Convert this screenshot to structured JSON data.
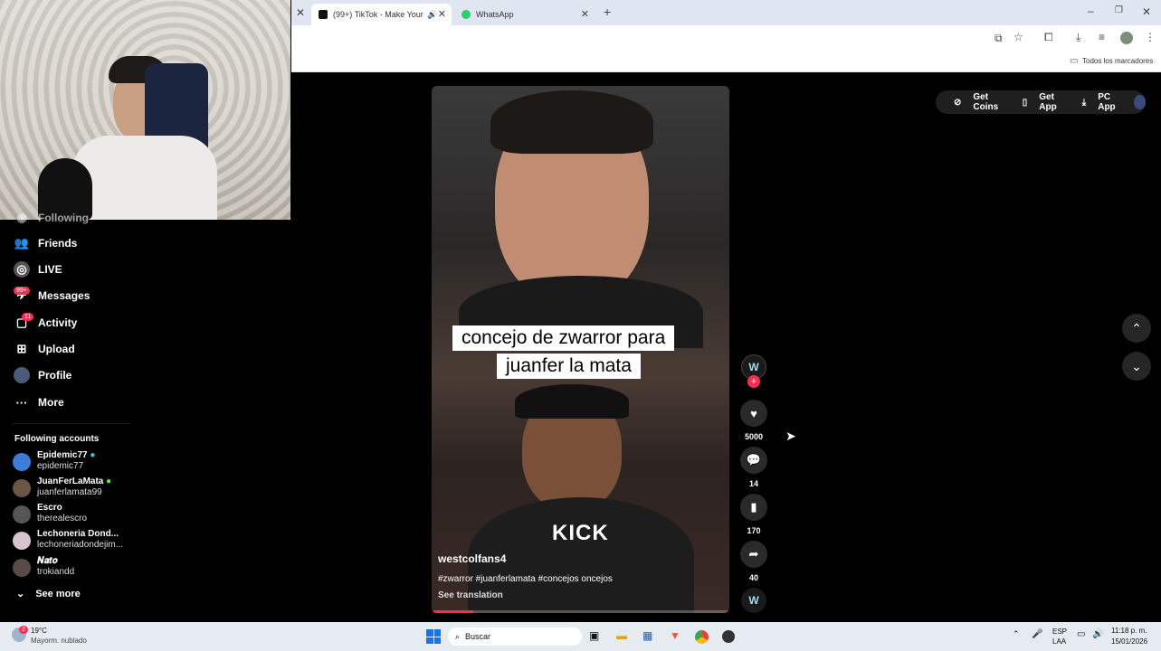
{
  "browser": {
    "tabs": [
      {
        "title": "(99+) TikTok - Make Your D..."
      },
      {
        "title": "WhatsApp"
      }
    ],
    "bookmarks_label": "Todos los marcadores"
  },
  "top_actions": {
    "get_coins": "Get Coins",
    "get_app": "Get App",
    "pc_app": "PC App"
  },
  "sidebar": {
    "partial_item": "Following",
    "items": [
      {
        "label": "Friends",
        "icon": "friends-icon"
      },
      {
        "label": "LIVE",
        "icon": "live-icon"
      },
      {
        "label": "Messages",
        "icon": "messages-icon",
        "badge": "99+"
      },
      {
        "label": "Activity",
        "icon": "activity-icon",
        "badge": "11"
      },
      {
        "label": "Upload",
        "icon": "upload-icon"
      },
      {
        "label": "Profile",
        "icon": "profile-icon"
      },
      {
        "label": "More",
        "icon": "more-icon"
      }
    ],
    "following_title": "Following accounts",
    "accounts": [
      {
        "name": "Epidemic77",
        "user": "epidemic77"
      },
      {
        "name": "JuanFerLaMata",
        "user": "juanferlamata99"
      },
      {
        "name": "Escro",
        "user": "therealescro"
      },
      {
        "name": "Lechoneria Dond...",
        "user": "lechoneriadondejim..."
      },
      {
        "name": "𝑵𝒂𝒕𝒐",
        "user": "trokiandd"
      }
    ],
    "see_more": "See more"
  },
  "video": {
    "caption_line1": "concejo de zwarror para",
    "caption_line2": "juanfer la mata",
    "watermark": "KICK",
    "author": "westcolfans4",
    "hashtags": "#zwarror #juanferlamata #concejos oncejos",
    "see_translation": "See translation",
    "progress": 0.14
  },
  "actions": {
    "likes": "5000",
    "comments": "14",
    "saves": "170",
    "shares": "40"
  },
  "taskbar": {
    "weather_temp": "19°C",
    "weather_desc": "Mayorm. nublado",
    "weather_badge": "2",
    "search": "Buscar",
    "lang1": "ESP",
    "lang2": "LAA",
    "time": "11:18 p. m.",
    "date": "15/01/2026"
  }
}
